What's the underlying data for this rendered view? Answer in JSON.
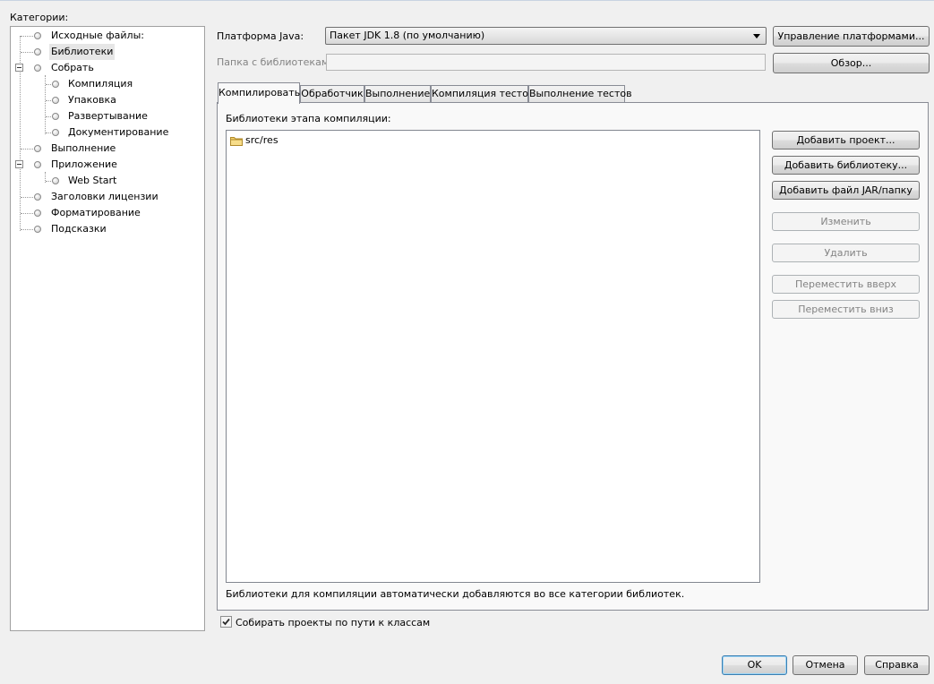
{
  "categories_label": "Категории:",
  "tree": [
    {
      "label": "Исходные файлы:"
    },
    {
      "label": "Библиотеки",
      "selected": true
    },
    {
      "label": "Собрать",
      "expanded": true
    },
    {
      "label": "Компиляция"
    },
    {
      "label": "Упаковка"
    },
    {
      "label": "Развертывание"
    },
    {
      "label": "Документирование"
    },
    {
      "label": "Выполнение"
    },
    {
      "label": "Приложение",
      "expanded": true
    },
    {
      "label": "Web Start"
    },
    {
      "label": "Заголовки лицензии"
    },
    {
      "label": "Форматирование"
    },
    {
      "label": "Подсказки"
    }
  ],
  "platform": {
    "label": "Платформа Java:",
    "value": "Пакет JDK 1.8 (по умолчанию)",
    "manage_button": "Управление платформами..."
  },
  "libfolder": {
    "label": "Папка с библиотеками:",
    "value": "",
    "browse_button": "Обзор..."
  },
  "tabs": [
    {
      "label": "Компилировать",
      "active": true
    },
    {
      "label": "Обработчик"
    },
    {
      "label": "Выполнение"
    },
    {
      "label": "Компиляция тестов"
    },
    {
      "label": "Выполнение тестов"
    }
  ],
  "compile": {
    "list_label": "Библиотеки этапа компиляции:",
    "items": [
      "src/res"
    ],
    "note": "Библиотеки для компиляции автоматически добавляются во все категории библиотек."
  },
  "side_buttons": {
    "add_project": "Добавить проект...",
    "add_library": "Добавить библиотеку...",
    "add_jar": "Добавить файл JAR/папку",
    "edit": "Изменить",
    "remove": "Удалить",
    "move_up": "Переместить вверх",
    "move_down": "Переместить вниз"
  },
  "build_checkbox": {
    "label": "Собирать проекты по пути к классам",
    "checked": true
  },
  "dialog_buttons": {
    "ok": "OK",
    "cancel": "Отмена",
    "help": "Справка"
  },
  "colors": {
    "background": "#f0f0f0",
    "panel": "#f9f9f9",
    "border": "#898c95",
    "disabled_text": "#838383"
  }
}
